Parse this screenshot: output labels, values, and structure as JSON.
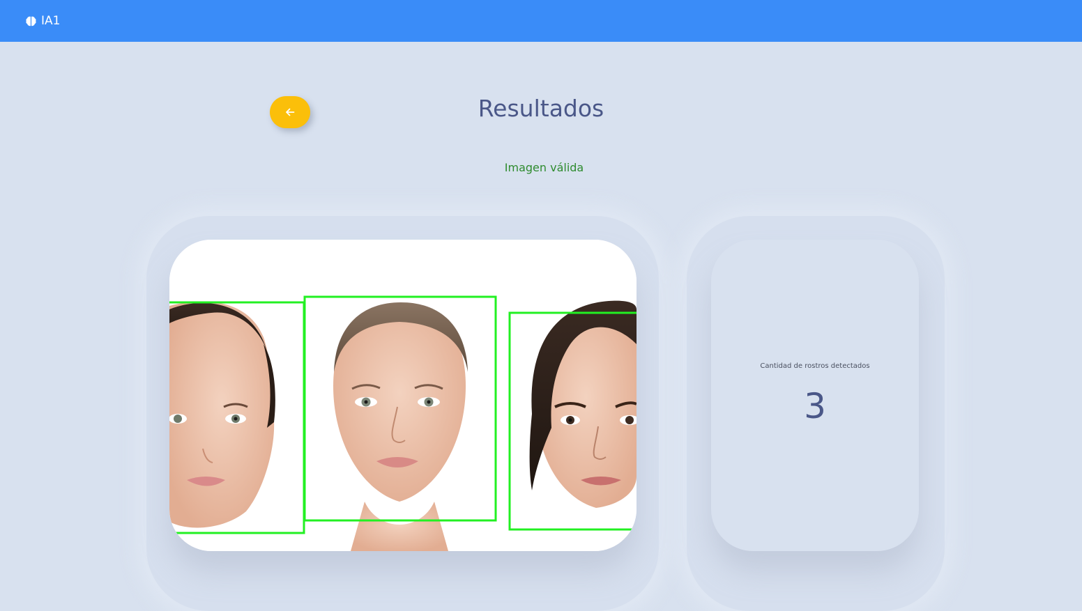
{
  "navbar": {
    "brand_label": "IA1",
    "brand_icon": "brain-icon",
    "background": "#3a8cf8"
  },
  "header": {
    "back_icon": "arrow-left-icon",
    "back_color": "#fbbf0a",
    "title": "Resultados"
  },
  "result": {
    "status_text": "Imagen válida",
    "status_color": "#2e8b2e"
  },
  "image": {
    "description_icon": "photo-with-face-detections",
    "detection_box_color": "#22f022"
  },
  "stats": {
    "label": "Cantidad de rostros detectados",
    "value": "3"
  }
}
